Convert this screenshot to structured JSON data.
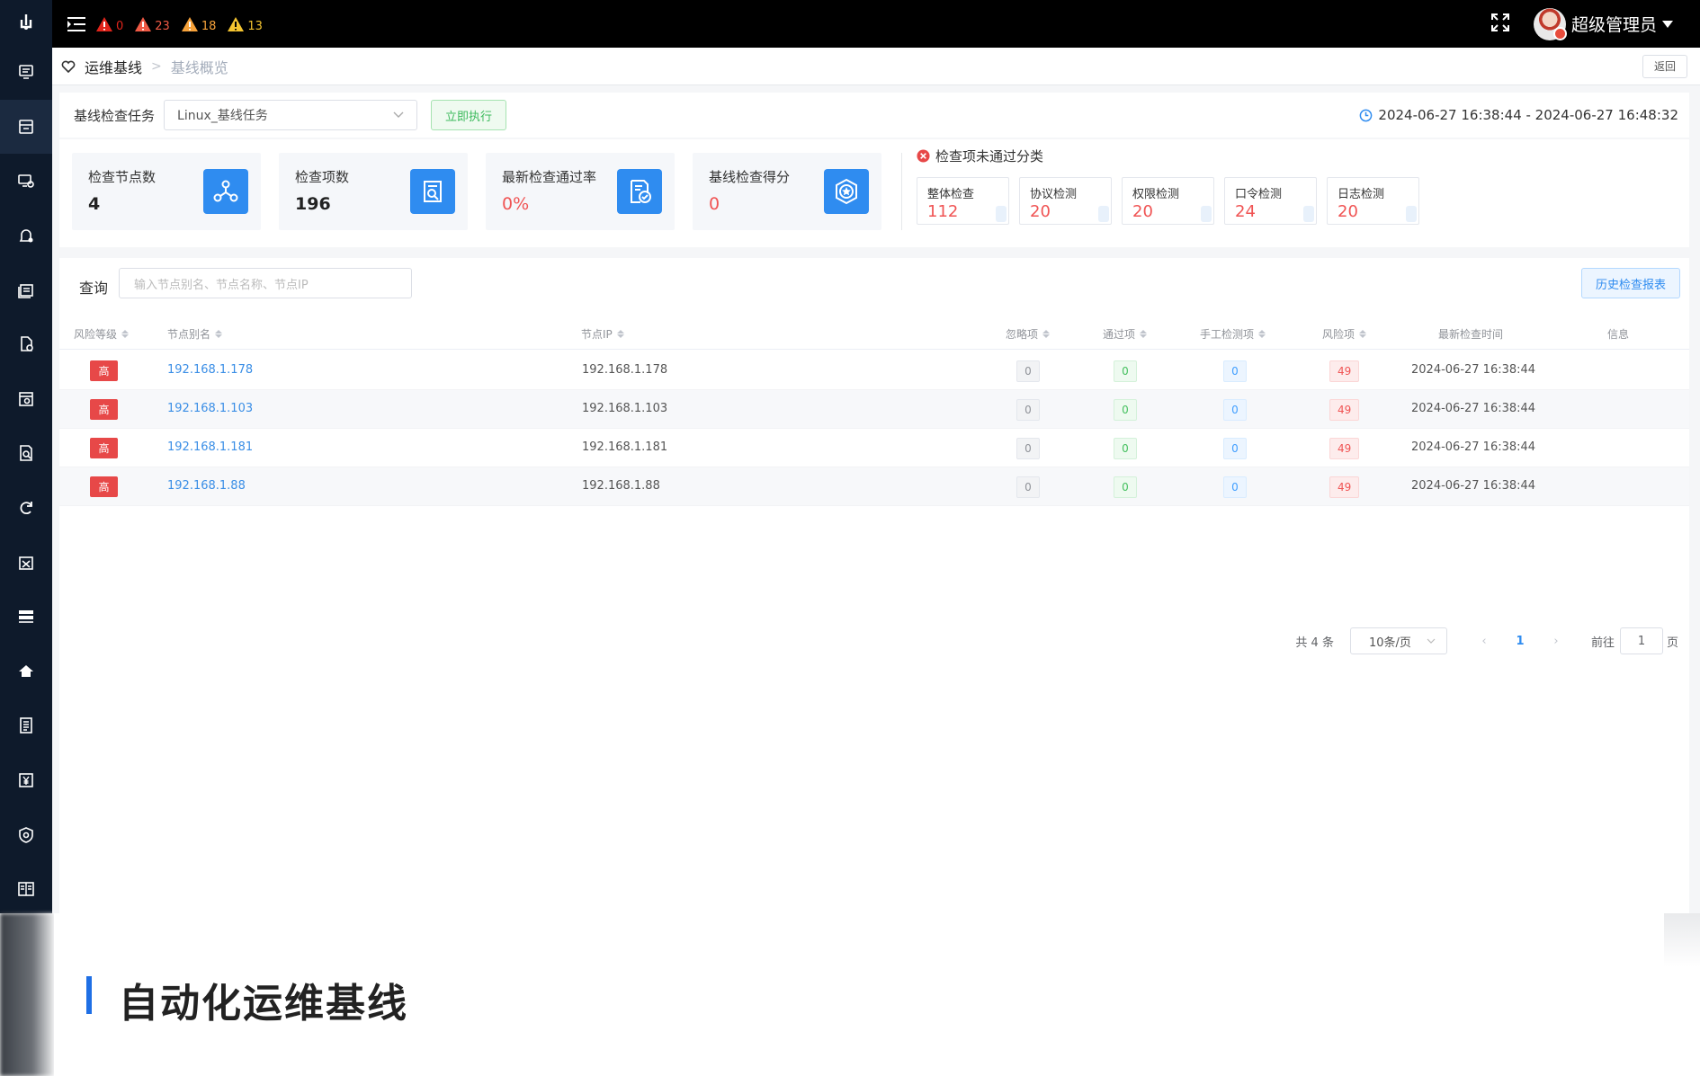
{
  "topbar": {
    "alerts": [
      {
        "count": "0",
        "color": "#e0241b"
      },
      {
        "count": "23",
        "color": "#f05a45"
      },
      {
        "count": "18",
        "color": "#f7a23a"
      },
      {
        "count": "13",
        "color": "#f4c430"
      }
    ],
    "user_name": "超级管理员"
  },
  "breadcrumb": {
    "section": "运维基线",
    "page": "基线概览",
    "back_label": "返回"
  },
  "task": {
    "label": "基线检查任务",
    "selected": "Linux_基线任务",
    "run_label": "立即执行",
    "time_range": "2024-06-27 16:38:44 - 2024-06-27 16:48:32"
  },
  "stats": [
    {
      "title": "检查节点数",
      "value": "4",
      "icon": "nodes-icon"
    },
    {
      "title": "检查项数",
      "value": "196",
      "icon": "search-doc-icon"
    },
    {
      "title": "最新检查通过率",
      "value": "0%",
      "icon": "doc-check-icon"
    },
    {
      "title": "基线检查得分",
      "value": "0",
      "icon": "shield-star-icon"
    }
  ],
  "fail_section": {
    "title": "检查项未通过分类",
    "items": [
      {
        "name": "整体检查",
        "value": "112"
      },
      {
        "name": "协议检测",
        "value": "20"
      },
      {
        "name": "权限检测",
        "value": "20"
      },
      {
        "name": "口令检测",
        "value": "24"
      },
      {
        "name": "日志检测",
        "value": "20"
      }
    ]
  },
  "query": {
    "label": "查询",
    "placeholder": "输入节点别名、节点名称、节点IP",
    "history_label": "历史检查报表"
  },
  "table": {
    "headers": {
      "risk": "风险等级",
      "alias": "节点别名",
      "ip": "节点IP",
      "ignored": "忽略项",
      "passed": "通过项",
      "manual": "手工检测项",
      "risky": "风险项",
      "last_time": "最新检查时间",
      "info": "信息"
    },
    "rows": [
      {
        "risk": "高",
        "alias": "192.168.1.178",
        "ip": "192.168.1.178",
        "ignored": "0",
        "passed": "0",
        "manual": "0",
        "risky": "49",
        "last_time": "2024-06-27 16:38:44"
      },
      {
        "risk": "高",
        "alias": "192.168.1.103",
        "ip": "192.168.1.103",
        "ignored": "0",
        "passed": "0",
        "manual": "0",
        "risky": "49",
        "last_time": "2024-06-27 16:38:44"
      },
      {
        "risk": "高",
        "alias": "192.168.1.181",
        "ip": "192.168.1.181",
        "ignored": "0",
        "passed": "0",
        "manual": "0",
        "risky": "49",
        "last_time": "2024-06-27 16:38:44"
      },
      {
        "risk": "高",
        "alias": "192.168.1.88",
        "ip": "192.168.1.88",
        "ignored": "0",
        "passed": "0",
        "manual": "0",
        "risky": "49",
        "last_time": "2024-06-27 16:38:44"
      }
    ]
  },
  "pagination": {
    "total": "共 4 条",
    "page_size": "10条/页",
    "current": "1",
    "goto_label": "前往",
    "goto_value": "1",
    "page_unit": "页"
  },
  "caption": {
    "text": "自动化运维基线",
    "accent": "#1f6fe5"
  }
}
